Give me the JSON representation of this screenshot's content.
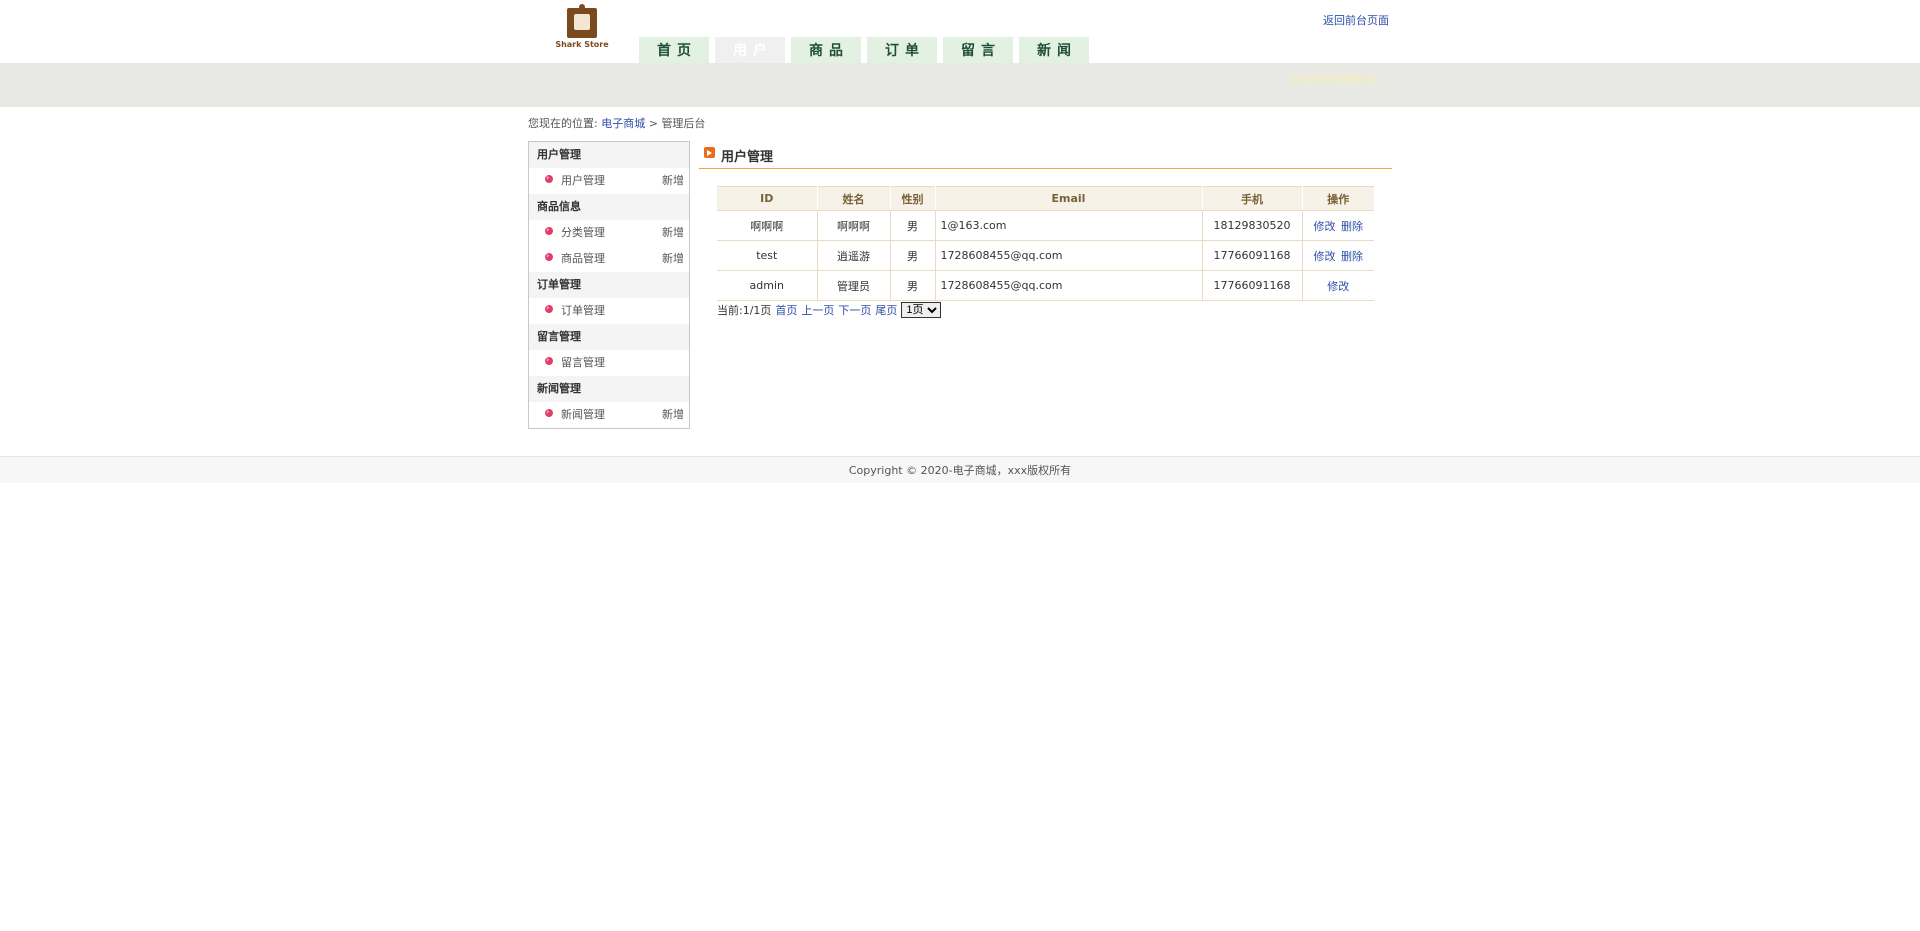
{
  "header": {
    "logo_text": "Shark Store",
    "back_link": "返回前台页面",
    "welcome": "欢迎来到管理后台。"
  },
  "nav": [
    {
      "label": "首页"
    },
    {
      "label": "用户",
      "active": true
    },
    {
      "label": "商品"
    },
    {
      "label": "订单"
    },
    {
      "label": "留言"
    },
    {
      "label": "新闻"
    }
  ],
  "breadcrumb": {
    "prefix": "您现在的位置:",
    "link": "电子商城",
    "separator": ">",
    "current": "管理后台"
  },
  "sidebar": {
    "groups": [
      {
        "title": "用户管理",
        "items": [
          {
            "label": "用户管理",
            "add": "新增"
          }
        ]
      },
      {
        "title": "商品信息",
        "items": [
          {
            "label": "分类管理",
            "add": "新增"
          },
          {
            "label": "商品管理",
            "add": "新增"
          }
        ]
      },
      {
        "title": "订单管理",
        "items": [
          {
            "label": "订单管理",
            "add": ""
          }
        ]
      },
      {
        "title": "留言管理",
        "items": [
          {
            "label": "留言管理",
            "add": ""
          }
        ]
      },
      {
        "title": "新闻管理",
        "items": [
          {
            "label": "新闻管理",
            "add": "新增"
          }
        ]
      }
    ]
  },
  "main": {
    "title": "用户管理",
    "table": {
      "headers": [
        "ID",
        "姓名",
        "性别",
        "Email",
        "手机",
        "操作"
      ],
      "rows": [
        {
          "id": "啊啊啊",
          "name": "啊啊啊",
          "gender": "男",
          "email": "1@163.com",
          "phone": "18129830520",
          "edit": "修改",
          "delete": "删除"
        },
        {
          "id": "test",
          "name": "逍遥游",
          "gender": "男",
          "email": "1728608455@qq.com",
          "phone": "17766091168",
          "edit": "修改",
          "delete": "删除"
        },
        {
          "id": "admin",
          "name": "管理员",
          "gender": "男",
          "email": "1728608455@qq.com",
          "phone": "17766091168",
          "edit": "修改",
          "delete": ""
        }
      ]
    },
    "pager": {
      "current": "当前:1/1页",
      "first": "首页",
      "prev": "上一页",
      "next": "下一页",
      "last": "尾页",
      "select_value": "1页"
    }
  },
  "footer": {
    "text": "Copyright © 2020-电子商城，xxx版权所有"
  }
}
